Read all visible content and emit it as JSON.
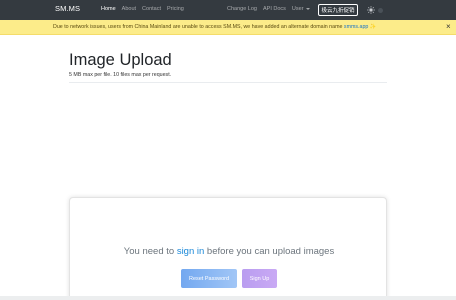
{
  "navbar": {
    "brand": "SM.MS",
    "left_items": [
      {
        "label": "Home",
        "active": true
      },
      {
        "label": "About",
        "active": false
      },
      {
        "label": "Contact",
        "active": false
      },
      {
        "label": "Pricing",
        "active": false
      }
    ],
    "right_items": [
      {
        "label": "Change Log"
      },
      {
        "label": "API Docs"
      },
      {
        "label": "User"
      }
    ],
    "promo_button": "极云九折促销",
    "theme_icon": "sun-icon",
    "colors": {
      "background": "#343a40",
      "text": "#ffffff"
    }
  },
  "alert": {
    "text": "Due to network issues, users from China Mainland are unable to access SM.MS, we have added an alternate domain name",
    "link": "smms.app",
    "emoji": "✨",
    "close": "×",
    "color": "#fcec8a"
  },
  "main": {
    "title": "Image Upload",
    "subtitle": "5 MB max per file. 10 files max per request."
  },
  "card": {
    "prompt_before": "You need to",
    "prompt_link": "sign in",
    "prompt_after": "before you can upload images",
    "reset_button": "Reset Password",
    "signup_button": "Sign Up"
  }
}
